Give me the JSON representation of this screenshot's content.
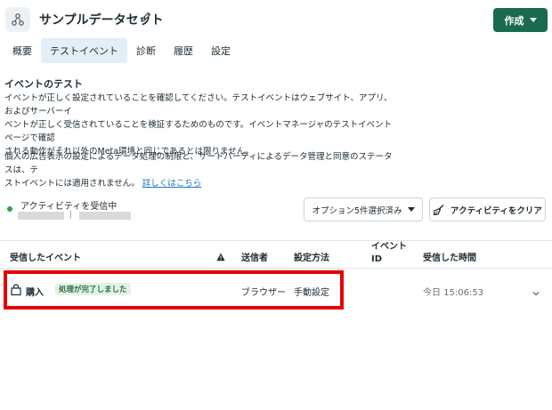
{
  "header": {
    "title": "サンプルデータセット",
    "create_label": "作成"
  },
  "tabs": [
    {
      "label": "概要"
    },
    {
      "label": "テストイベント",
      "active": true
    },
    {
      "label": "診断"
    },
    {
      "label": "履歴"
    },
    {
      "label": "設定"
    }
  ],
  "section": {
    "heading": "イベントのテスト",
    "para1_lines": [
      "イベントが正しく設定されていることを確認してください。テストイベントはウェブサイト、アプリ、およびサーバーイ",
      "ベントが正しく受信されていることを検証するためのものです。イベントマネージャのテストイベントページで確認",
      "される動作がそれ以外のMeta環境と同じであるとは限りません。"
    ],
    "para2_lines": [
      "個人の広告表示の設定によるデータ処理の制限と、サードパーティによるデータ管理と同意のステータスは、テ",
      "ストイベントには適用されません。"
    ],
    "learn_more": "詳しくはこちら"
  },
  "activity": {
    "status": "アクティビティを受信中",
    "separator": "|",
    "options_label": "オプション5件選択済み",
    "clear_label": "アクティビティをクリア"
  },
  "table": {
    "headers": {
      "event": "受信したイベント",
      "sender": "送信者",
      "method": "設定方法",
      "event_id_line1": "イベント",
      "event_id_line2": "ID",
      "time": "受信した時間"
    },
    "rows": [
      {
        "event": "購入",
        "badge": "処理が完了しました",
        "sender": "ブラウザー",
        "method": "手動設定",
        "time": "今日 15:06:53"
      }
    ]
  },
  "colors": {
    "accent": "#1a6b4e",
    "highlight": "#e60000",
    "status_green": "#31a24c",
    "link": "#1877c9"
  }
}
